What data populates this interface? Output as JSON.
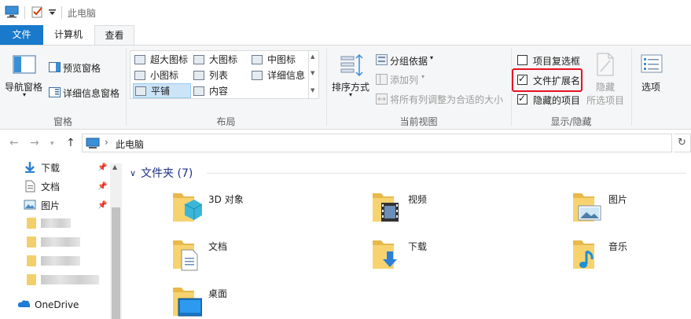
{
  "window": {
    "title": "此电脑"
  },
  "tabs": {
    "file": "文件",
    "computer": "计算机",
    "view": "查看"
  },
  "ribbon": {
    "panes": {
      "nav_pane": "导航窗格",
      "preview_pane": "预览窗格",
      "details_pane": "详细信息窗格",
      "group_label": "窗格"
    },
    "layout": {
      "items": [
        "超大图标",
        "大图标",
        "中图标",
        "小图标",
        "列表",
        "详细信息",
        "平铺",
        "内容"
      ],
      "selected": "平铺",
      "group_label": "布局"
    },
    "current_view": {
      "sort_by": "排序方式",
      "group_by": "分组依据",
      "add_column": "添加列",
      "fit_columns": "将所有列调整为合适的大小",
      "group_label": "当前视图"
    },
    "show_hide": {
      "item_checkboxes": {
        "label": "项目复选框",
        "checked": false
      },
      "file_extensions": {
        "label": "文件扩展名",
        "checked": true
      },
      "hidden_items": {
        "label": "隐藏的项目",
        "checked": true
      },
      "hide_selected_top": "隐藏",
      "hide_selected_bottom": "所选项目",
      "group_label": "显示/隐藏"
    },
    "options": "选项"
  },
  "address": {
    "path": "此电脑"
  },
  "nav": {
    "quick_access": [
      {
        "label": "下载",
        "icon": "download-arrow-icon"
      },
      {
        "label": "文档",
        "icon": "document-icon"
      },
      {
        "label": "图片",
        "icon": "picture-icon"
      }
    ],
    "onedrive": "OneDrive"
  },
  "content": {
    "section_title": "文件夹 (7)",
    "folders": [
      {
        "label": "3D 对象",
        "icon": "3d-objects-folder-icon"
      },
      {
        "label": "视频",
        "icon": "videos-folder-icon"
      },
      {
        "label": "图片",
        "icon": "pictures-folder-icon"
      },
      {
        "label": "文档",
        "icon": "documents-folder-icon"
      },
      {
        "label": "下载",
        "icon": "downloads-folder-icon"
      },
      {
        "label": "音乐",
        "icon": "music-folder-icon"
      },
      {
        "label": "桌面",
        "icon": "desktop-folder-icon"
      }
    ]
  },
  "colors": {
    "accent": "#1979ca",
    "highlight": "#e81123",
    "folder": "#f2cf6a",
    "section_title": "#1e3287"
  }
}
